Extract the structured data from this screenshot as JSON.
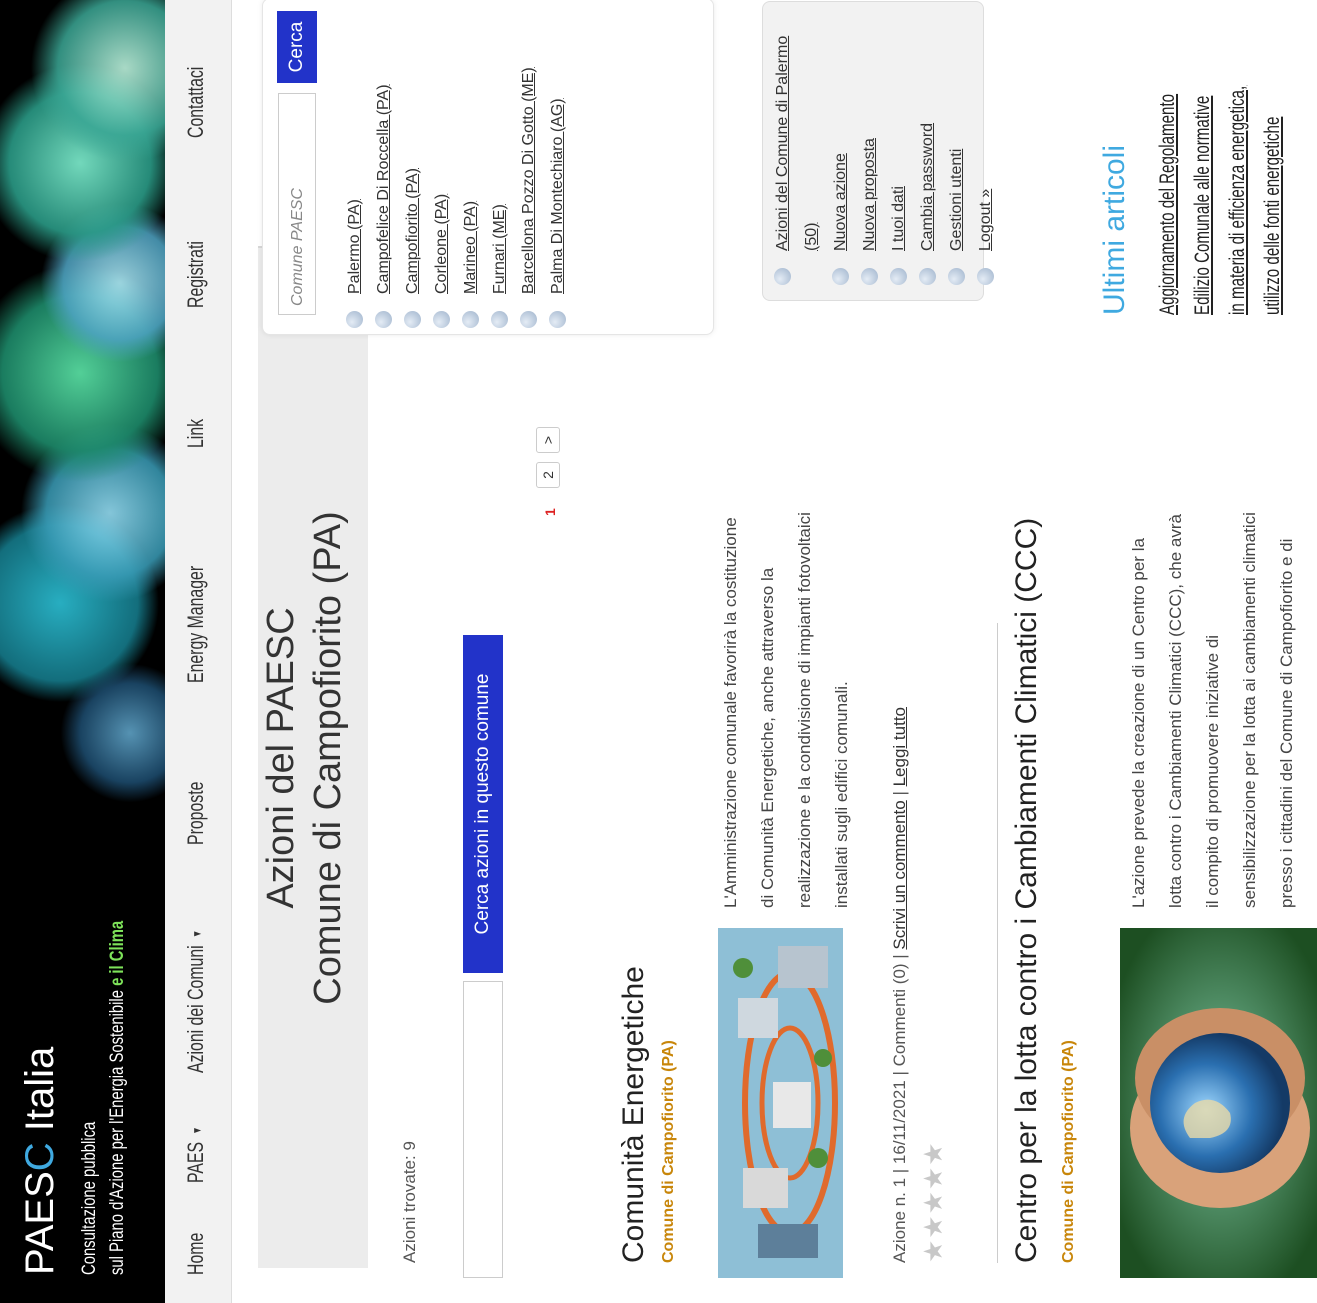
{
  "header": {
    "brand_main": "PAES",
    "brand_accent": "C",
    "brand_rest": " Italia",
    "subtitle_line1": "Consultazione pubblica",
    "subtitle_line2_start": "sul Piano d'Azione per l'Energia Sostenibile",
    "subtitle_line2_green": " e il Clima"
  },
  "nav": {
    "items": [
      {
        "label": "Home"
      },
      {
        "label": "PAES",
        "dropdown": true
      },
      {
        "label": "Azioni dei Comuni",
        "dropdown": true
      },
      {
        "label": "Proposte"
      },
      {
        "label": "Energy Manager"
      },
      {
        "label": "Link"
      },
      {
        "label": "Registrati"
      },
      {
        "label": "Contattaci"
      }
    ]
  },
  "main": {
    "title_line1": "Azioni del PAESC",
    "title_line2": "Comune di Campofiorito (PA)",
    "found_text": "Azioni trovate: 9",
    "search_button": "Cerca azioni in questo comune",
    "search_value": "",
    "pagination": {
      "current": "1",
      "page2": "2",
      "next": ">"
    }
  },
  "articles": [
    {
      "title": "Comunità Energetiche",
      "comune": "Comune di Campofiorito (PA)",
      "text_lines": [
        "L'Amministrazione comunale favorirà la costituzione",
        "di Comunità Energetiche, anche attraverso la",
        "realizzazione e la condivisione di impianti fotovoltaici",
        "installati sugli edifici comunali."
      ],
      "meta": "Azione n. 1 | 16/11/2021 | Commenti (0) | ",
      "link_comment": "Scrivi un commento",
      "sep": " | ",
      "link_read": "Leggi tutto",
      "rating": 0,
      "max_rating": 5
    },
    {
      "title": "Centro per la lotta contro i Cambiamenti Climatici (CCC)",
      "comune": "Comune di Campofiorito (PA)",
      "text_lines": [
        "L'azione prevede la creazione di un Centro per la",
        "lotta contro i Cambiamenti Climatici (CCC), che avrà",
        "il compito di promuovere iniziative di",
        "sensibilizzazione per la lotta ai cambiamenti climatici",
        "presso i cittadini del Comune di Campofiorito e di"
      ]
    }
  ],
  "sidebar": {
    "search_placeholder": "Comune PAESC",
    "search_button": "Cerca",
    "comuni": [
      "Palermo (PA)",
      "Campofelice Di Roccella (PA)",
      "Campofiorito (PA)",
      "Corleone (PA)",
      "Marineo (PA)",
      "Furnari (ME)",
      "Barcellona Pozzo Di Gotto (ME)",
      "Palma Di Montechiaro (AG)"
    ],
    "user_menu": [
      "Azioni del Comune di Palermo (50)",
      "Nuova azione",
      "Nuova proposta",
      "I tuoi dati",
      "Cambia password",
      "Gestioni utenti",
      "Logout »"
    ],
    "latest_title": "Ultimi articoli",
    "latest_article": "Aggiornamento del Regolamento Edilizio Comunale alle normative in materia di efficienza energetica, utilizzo delle fonti energetiche"
  },
  "colors": {
    "accent_blue": "#2233c9",
    "brand_light_blue": "#3fa9e0",
    "comune_orange": "#c8860a",
    "green_clima": "#7ee35a",
    "pager_red": "#dd2222"
  }
}
